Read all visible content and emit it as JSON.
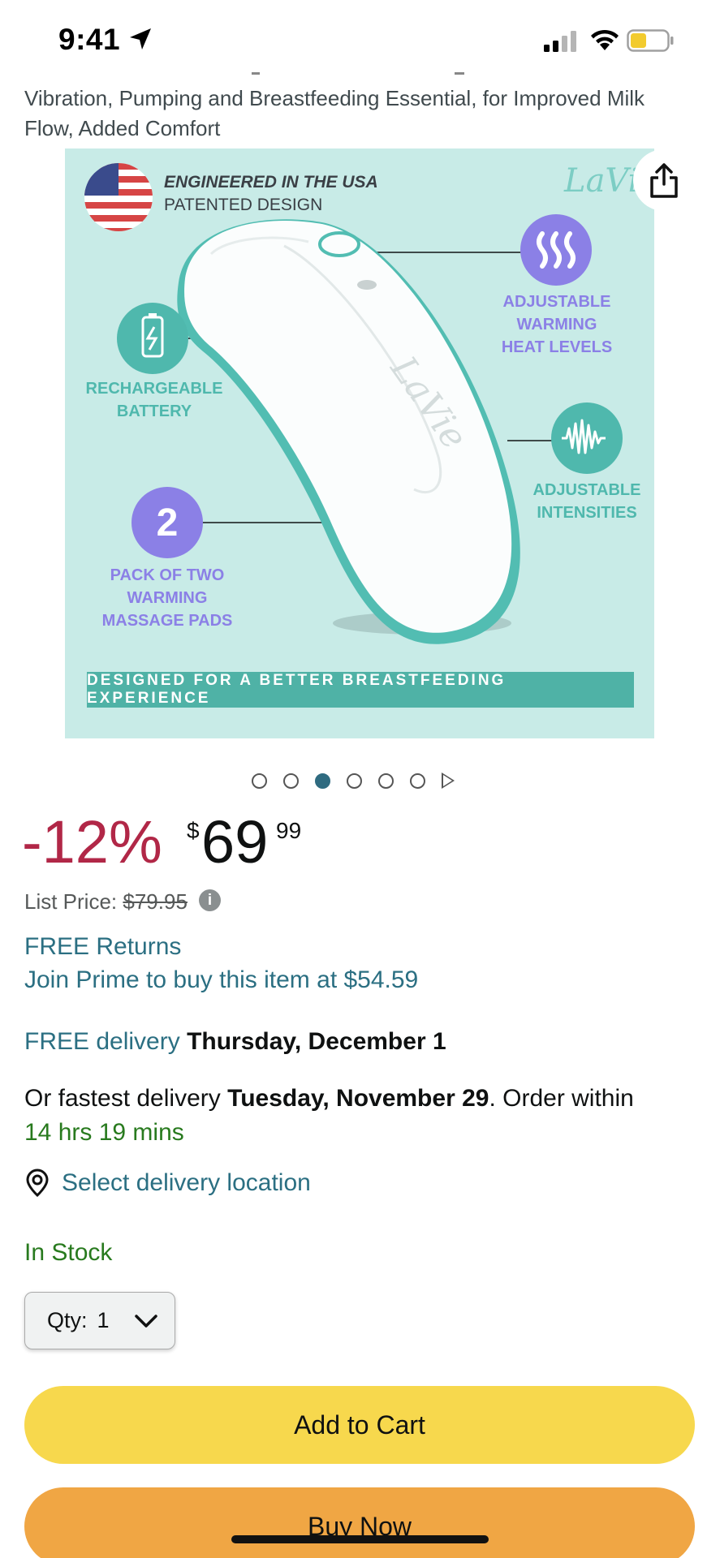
{
  "status_bar": {
    "time": "9:41"
  },
  "product": {
    "title": "Vibration, Pumping and Breastfeeding Essential, for Improved Milk Flow, Added Comfort",
    "image": {
      "engineered": "ENGINEERED IN THE USA",
      "patented": "PATENTED DESIGN",
      "brand": "LaVie",
      "feature_warming": "ADJUSTABLE WARMING HEAT LEVELS",
      "feature_battery": "RECHARGEABLE BATTERY",
      "feature_intensities": "ADJUSTABLE INTENSITIES",
      "feature_pack_number": "2",
      "feature_pack": "PACK OF TWO WARMING MASSAGE PADS",
      "banner": "DESIGNED FOR A BETTER BREASTFEEDING EXPERIENCE"
    },
    "carousel": {
      "count": 6,
      "active_index": 2
    }
  },
  "price": {
    "discount": "-12%",
    "currency": "$",
    "whole": "69",
    "fraction": "99",
    "list_label": "List Price:",
    "list_value": "$79.95"
  },
  "offers": {
    "free_returns": "FREE Returns",
    "prime": "Join Prime to buy this item at $54.59",
    "delivery_label": "FREE delivery",
    "delivery_date": "Thursday, December 1",
    "fastest_prefix": "Or fastest delivery",
    "fastest_date": "Tuesday, November 29",
    "fastest_suffix": ". Order within",
    "countdown": "14 hrs 19 mins",
    "location": "Select delivery location"
  },
  "stock": "In Stock",
  "quantity": {
    "label": "Qty:",
    "value": "1"
  },
  "actions": {
    "add_to_cart": "Add to Cart",
    "buy_now": "Buy Now"
  },
  "colors": {
    "link": "#2b6f82",
    "discount": "#b12747",
    "stock_green": "#287a1e",
    "add_cart": "#f7d84d",
    "buy_now": "#f0a644",
    "image_bg": "#c8ebe7"
  }
}
